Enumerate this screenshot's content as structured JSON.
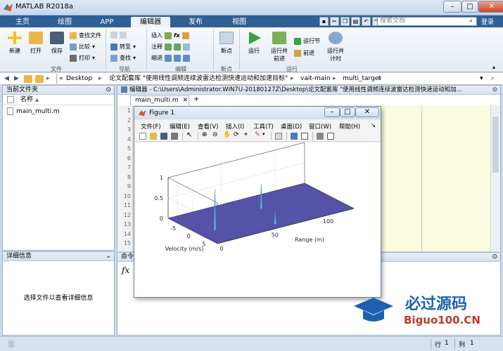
{
  "window": {
    "title": "MATLAB R2018a",
    "min": "–",
    "max": "□",
    "close": "✕"
  },
  "ribbon_tabs": [
    "主页",
    "绘图",
    "APP",
    "编辑器",
    "发布",
    "视图"
  ],
  "search": {
    "placeholder": "搜索文档"
  },
  "login": "登录",
  "ribbon": {
    "file": {
      "new": "新建",
      "open": "打开",
      "save": "保存",
      "find_files": "查找文件",
      "compare": "比较",
      "print": "打印",
      "group": "文件"
    },
    "nav": {
      "goto": "转至",
      "find": "查找",
      "group": "导航"
    },
    "edit": {
      "insert": "插入",
      "comment": "注释",
      "indent": "缩进",
      "fx": "fx",
      "group": "编辑"
    },
    "breakpoints": {
      "label": "断点",
      "group": "断点"
    },
    "run": {
      "run": "运行",
      "run_advance_1": "运行并",
      "run_advance_2": "前进",
      "run_section": "运行节",
      "advance": "前进",
      "run_time_1": "运行并",
      "run_time_2": "计时",
      "group": "运行"
    }
  },
  "address": {
    "prefix": "«",
    "path": [
      "Desktop",
      "论文配套库 \"使用线性调频连续波雷达检测快速运动和加速目标\"",
      "vait-main",
      "multi_target"
    ]
  },
  "left_panel": {
    "title": "当前文件夹",
    "col_name": "名称",
    "col_sort": "▲",
    "file": "main_multi.m"
  },
  "detail_panel": {
    "title": "详细信息",
    "message": "选择文件以查看详细信息"
  },
  "editor": {
    "title": "编辑器 - C:\\Users\\Administrator.WIN7U-20180127Z\\Desktop\\论文配套库 \"使用线性调频连续波雷达检测快速运动和加...",
    "tab": "main_multi.m",
    "add_tab": "+",
    "line_numbers": [
      "1",
      "2",
      "3",
      "4",
      "5",
      "6",
      "7",
      "8",
      "9",
      "10",
      "11",
      "12",
      "13",
      "14",
      "15"
    ]
  },
  "cmd": {
    "title": "命令",
    "fx": "fx"
  },
  "status": {
    "row_label": "行",
    "row": "1",
    "col_label": "列",
    "col": "1"
  },
  "figure": {
    "title": "Figure 1",
    "menu": [
      "文件(F)",
      "编辑(E)",
      "查看(V)",
      "插入(I)",
      "工具(T)",
      "桌面(D)",
      "窗口(W)",
      "帮助(H)"
    ]
  },
  "chart_data": {
    "type": "surface",
    "title": "",
    "xlabel": "Range (m)",
    "ylabel": "Velocity (m/s)",
    "zlabel": "",
    "x_ticks": [
      "0",
      "50",
      "100"
    ],
    "y_ticks": [
      "-5",
      "0",
      "5"
    ],
    "z_ticks": [
      "0",
      "0.5",
      "1"
    ],
    "xlim": [
      0,
      128
    ],
    "ylim": [
      -8,
      8
    ],
    "zlim": [
      0,
      1
    ],
    "surface_color": "#5552a8",
    "peaks": [
      {
        "range": 60,
        "velocity": 6,
        "height": 0.35
      },
      {
        "range": 15,
        "velocity": 2,
        "height": 1.0
      },
      {
        "range": 70,
        "velocity": -2,
        "height": 0.6
      }
    ],
    "grid": true
  },
  "watermark": {
    "brand": "必过源码",
    "url": "Biguo100.CN"
  }
}
